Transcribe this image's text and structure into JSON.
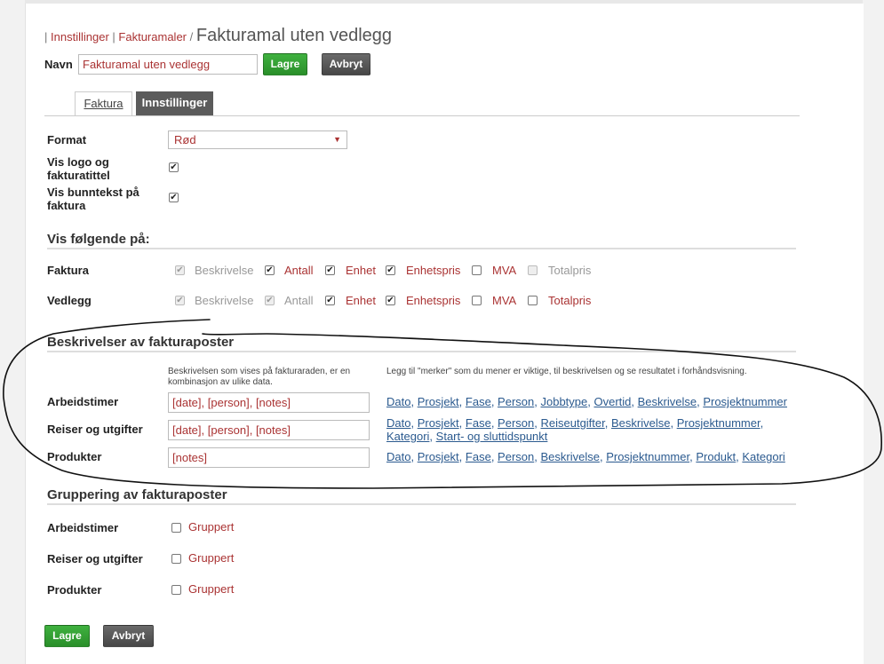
{
  "breadcrumb": {
    "item1": "Innstillinger",
    "item2": "Fakturamaler",
    "sep1": "|",
    "sep2": "|",
    "sep3": "/",
    "current": "Fakturamal uten vedlegg"
  },
  "name_row": {
    "label": "Navn",
    "value": "Fakturamal uten vedlegg",
    "save": "Lagre",
    "cancel": "Avbryt"
  },
  "tabs": [
    "Faktura",
    "Innstillinger"
  ],
  "settings": {
    "format_label": "Format",
    "format_value": "Rød",
    "logo_label": "Vis logo og fakturatittel",
    "footer_label": "Vis bunntekst på faktura"
  },
  "show_on": {
    "heading": "Vis følgende på:",
    "rows": [
      {
        "label": "Faktura",
        "opts": [
          "Beskrivelse",
          "Antall",
          "Enhet",
          "Enhetspris",
          "MVA",
          "Totalpris"
        ]
      },
      {
        "label": "Vedlegg",
        "opts": [
          "Beskrivelse",
          "Antall",
          "Enhet",
          "Enhetspris",
          "MVA",
          "Totalpris"
        ]
      }
    ]
  },
  "descriptions": {
    "heading": "Beskrivelser av fakturaposter",
    "help_left": "Beskrivelsen som vises på fakturaraden, er en kombinasjon av ulike data.",
    "help_right": "Legg til \"merker\" som du mener er viktige, til beskrivelsen og se resultatet i forhåndsvisning.",
    "rows": [
      {
        "label": "Arbeidstimer",
        "value": "[date], [person], [notes]",
        "tags": [
          "Dato",
          "Prosjekt",
          "Fase",
          "Person",
          "Jobbtype",
          "Overtid",
          "Beskrivelse",
          "Prosjektnummer"
        ]
      },
      {
        "label": "Reiser og utgifter",
        "value": "[date], [person], [notes]",
        "tags": [
          "Dato",
          "Prosjekt",
          "Fase",
          "Person",
          "Reiseutgifter",
          "Beskrivelse",
          "Prosjektnummer",
          "Kategori",
          "Start- og sluttidspunkt"
        ]
      },
      {
        "label": "Produkter",
        "value": "[notes]",
        "tags": [
          "Dato",
          "Prosjekt",
          "Fase",
          "Person",
          "Beskrivelse",
          "Prosjektnummer",
          "Produkt",
          "Kategori"
        ]
      }
    ]
  },
  "grouping": {
    "heading": "Gruppering av fakturaposter",
    "rows": [
      {
        "label": "Arbeidstimer",
        "opt": "Gruppert"
      },
      {
        "label": "Reiser og utgifter",
        "opt": "Gruppert"
      },
      {
        "label": "Produkter",
        "opt": "Gruppert"
      }
    ]
  },
  "footer": {
    "save": "Lagre",
    "cancel": "Avbryt"
  },
  "colors": {
    "accent_red": "#aa3333",
    "green": "#2f9e2f",
    "dark_button": "#555555",
    "link_blue": "#2b5a8f"
  }
}
